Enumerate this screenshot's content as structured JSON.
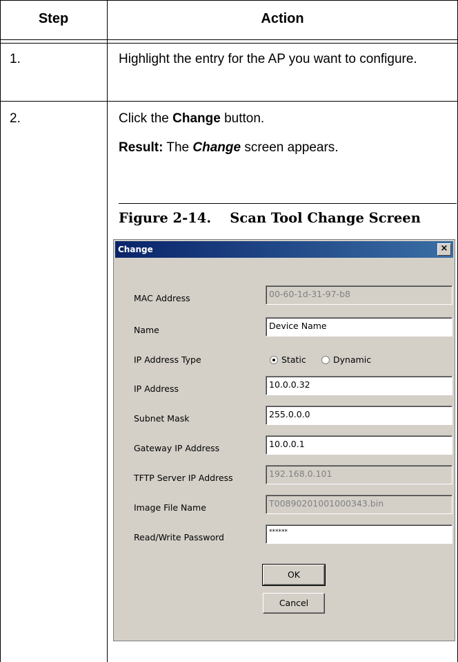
{
  "table": {
    "headers": {
      "step": "Step",
      "action": "Action"
    },
    "rows": [
      {
        "step": "1.",
        "action": "Highlight the entry for the AP you want to configure."
      },
      {
        "step": "2.",
        "action_prefix": "Click the ",
        "action_bold": "Change",
        "action_suffix": " button.",
        "result_label": "Result:",
        "result_pre": " The ",
        "result_em": "Change",
        "result_post": " screen appears."
      }
    ]
  },
  "figure": {
    "caption": "Figure 2-14.    Scan Tool Change Screen"
  },
  "dialog": {
    "title": "Change",
    "close_glyph": "×",
    "fields": {
      "mac": {
        "label": "MAC Address",
        "value": "00-60-1d-31-97-b8"
      },
      "name": {
        "label": "Name",
        "value": "Device Name"
      },
      "ip_type": {
        "label": "IP Address Type",
        "static": "Static",
        "dynamic": "Dynamic",
        "selected": "Static"
      },
      "ip": {
        "label": "IP Address",
        "value": "10.0.0.32"
      },
      "subnet": {
        "label": "Subnet Mask",
        "value": "255.0.0.0"
      },
      "gateway": {
        "label": "Gateway IP Address",
        "value": "10.0.0.1"
      },
      "tftp": {
        "label": "TFTP Server IP Address",
        "value": "192.168.0.101"
      },
      "image": {
        "label": "Image File Name",
        "value": "T00890201001000343.bin"
      },
      "password": {
        "label": "Read/Write Password",
        "value": "******"
      }
    },
    "buttons": {
      "ok": "OK",
      "cancel": "Cancel"
    }
  }
}
